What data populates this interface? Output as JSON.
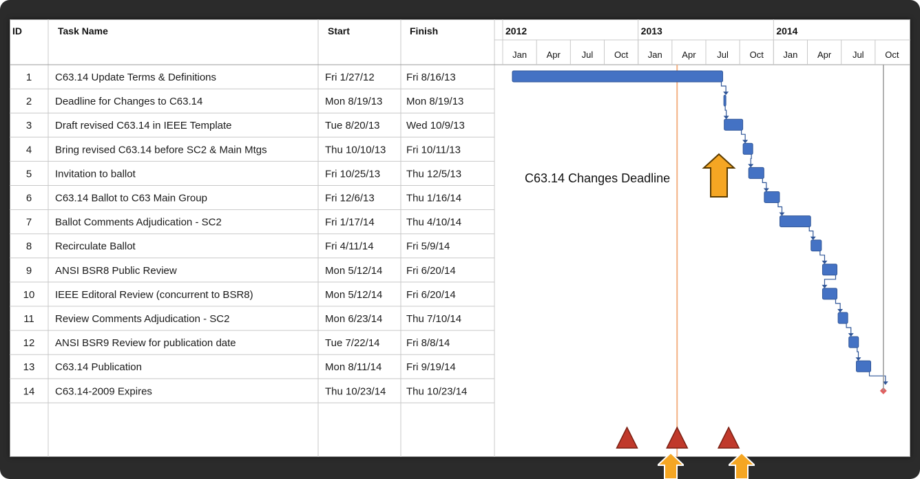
{
  "columns": {
    "id": "ID",
    "name": "Task Name",
    "start": "Start",
    "finish": "Finish"
  },
  "chart_data": {
    "type": "gantt",
    "timescale": {
      "years": [
        "2012",
        "2013",
        "2014"
      ],
      "months": [
        "Jan",
        "Apr",
        "Jul",
        "Oct",
        "Jan",
        "Apr",
        "Jul",
        "Oct",
        "Jan",
        "Apr",
        "Jul",
        "Oct"
      ]
    },
    "tasks": [
      {
        "id": "1",
        "name": "C63.14 Update Terms & Definitions",
        "start": "Fri 1/27/12",
        "finish": "Fri 8/16/13",
        "s": "2012-01-27",
        "f": "2013-08-16"
      },
      {
        "id": "2",
        "name": "Deadline for Changes to C63.14",
        "start": "Mon 8/19/13",
        "finish": "Mon 8/19/13",
        "s": "2013-08-19",
        "f": "2013-08-19"
      },
      {
        "id": "3",
        "name": "Draft revised C63.14 in IEEE Template",
        "start": "Tue 8/20/13",
        "finish": "Wed 10/9/13",
        "s": "2013-08-20",
        "f": "2013-10-09"
      },
      {
        "id": "4",
        "name": "Bring revised C63.14 before SC2 & Main Mtgs",
        "start": "Thu 10/10/13",
        "finish": "Fri 10/11/13",
        "s": "2013-10-10",
        "f": "2013-10-11"
      },
      {
        "id": "5",
        "name": "Invitation to ballot",
        "start": "Fri 10/25/13",
        "finish": "Thu 12/5/13",
        "s": "2013-10-25",
        "f": "2013-12-05"
      },
      {
        "id": "6",
        "name": "C63.14 Ballot to C63 Main Group",
        "start": "Fri 12/6/13",
        "finish": "Thu 1/16/14",
        "s": "2013-12-06",
        "f": "2014-01-16"
      },
      {
        "id": "7",
        "name": "Ballot Comments Adjudication - SC2",
        "start": "Fri 1/17/14",
        "finish": "Thu 4/10/14",
        "s": "2014-01-17",
        "f": "2014-04-10"
      },
      {
        "id": "8",
        "name": "Recirculate Ballot",
        "start": "Fri 4/11/14",
        "finish": "Fri 5/9/14",
        "s": "2014-04-11",
        "f": "2014-05-09"
      },
      {
        "id": "9",
        "name": "ANSI BSR8 Public Review",
        "start": "Mon 5/12/14",
        "finish": "Fri 6/20/14",
        "s": "2014-05-12",
        "f": "2014-06-20"
      },
      {
        "id": "10",
        "name": "IEEE Editoral Review (concurrent to BSR8)",
        "start": "Mon 5/12/14",
        "finish": "Fri 6/20/14",
        "s": "2014-05-12",
        "f": "2014-06-20"
      },
      {
        "id": "11",
        "name": "Review Comments Adjudication - SC2",
        "start": "Mon 6/23/14",
        "finish": "Thu 7/10/14",
        "s": "2014-06-23",
        "f": "2014-07-10"
      },
      {
        "id": "12",
        "name": "ANSI BSR9 Review for publication date",
        "start": "Tue 7/22/14",
        "finish": "Fri 8/8/14",
        "s": "2014-07-22",
        "f": "2014-08-08"
      },
      {
        "id": "13",
        "name": "C63.14 Publication",
        "start": "Mon 8/11/14",
        "finish": "Fri 9/19/14",
        "s": "2014-08-11",
        "f": "2014-09-19"
      },
      {
        "id": "14",
        "name": "C63.14-2009 Expires",
        "start": "Thu 10/23/14",
        "finish": "Thu 10/23/14",
        "s": "2014-10-23",
        "f": "2014-10-23"
      }
    ],
    "today_line": "2013-04-15",
    "annotation": "C63.14 Changes Deadline",
    "triangle_markers": [
      "2012-12-01",
      "2013-04-15",
      "2013-09-01"
    ],
    "colors": {
      "bar": "#4472c4",
      "bar_dark": "#2f5597",
      "today": "#f4b183",
      "arrow": "#f5a623",
      "triangle": "#c0392b",
      "milestone": "#e06060"
    }
  }
}
